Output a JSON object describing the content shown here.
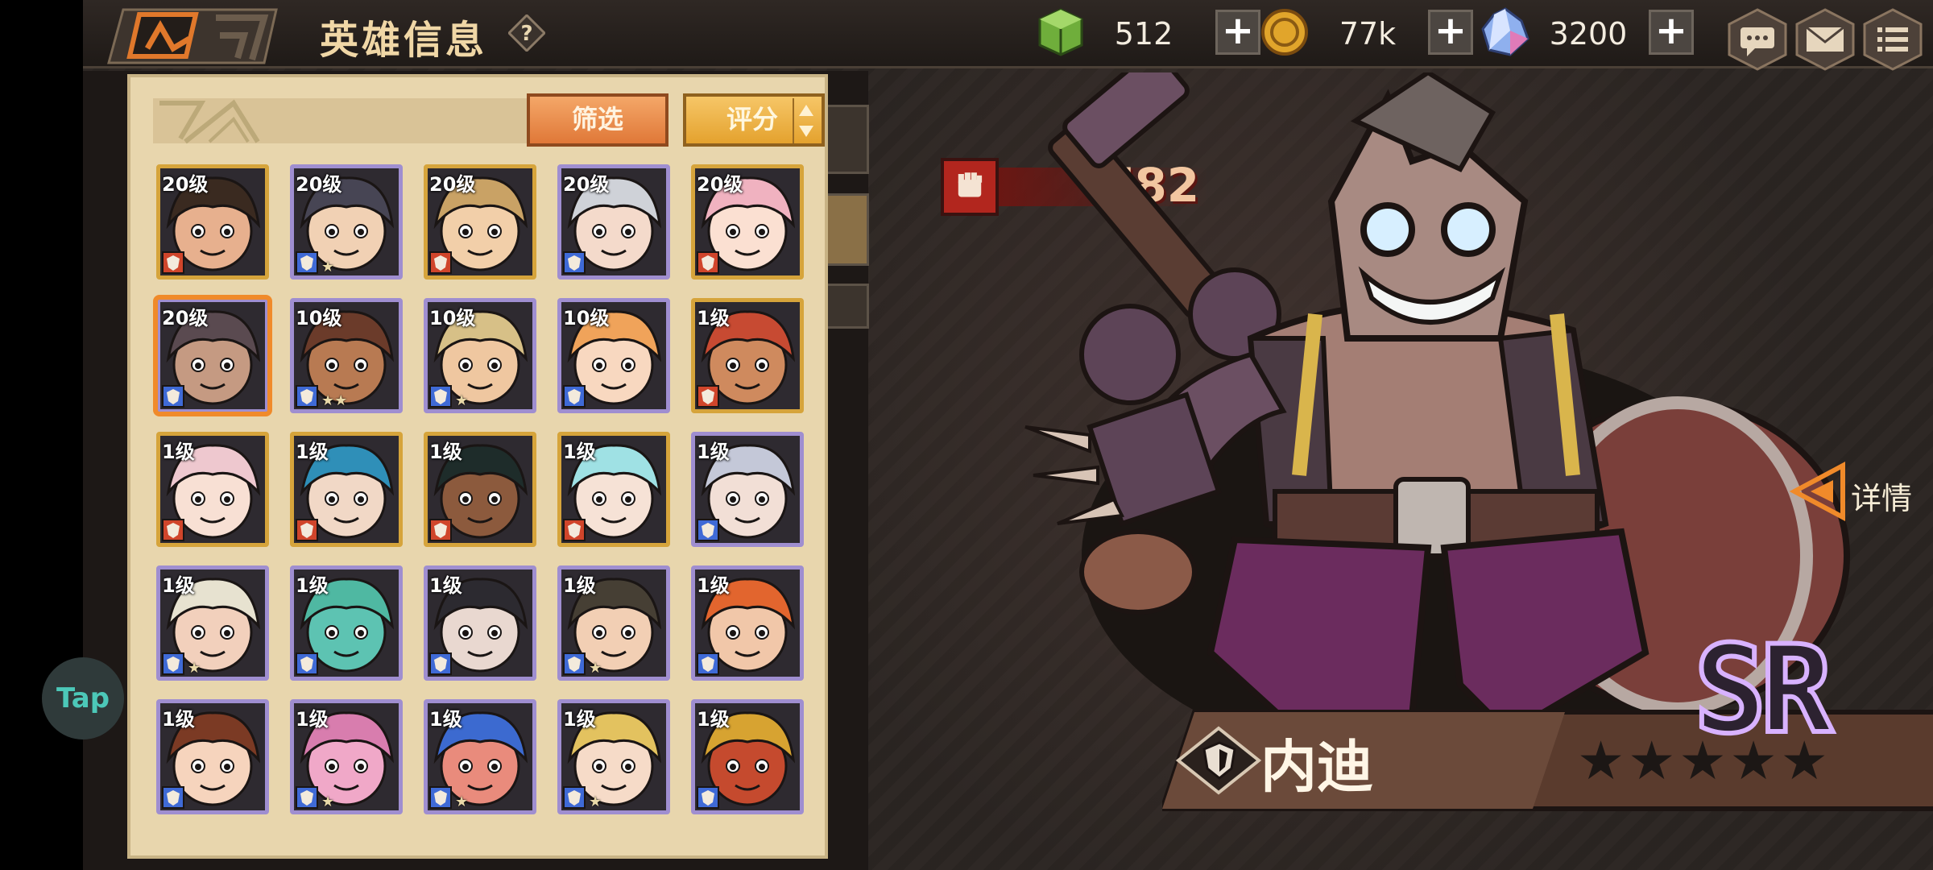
{
  "header": {
    "title": "英雄信息",
    "help_icon": "question-icon",
    "resources": [
      {
        "name": "energy",
        "icon": "green-cube-icon",
        "value": "512",
        "color": "#7fc24a"
      },
      {
        "name": "gold",
        "icon": "gold-coin-icon",
        "value": "77k",
        "color": "#e1a52b"
      },
      {
        "name": "crystal",
        "icon": "crystal-icon",
        "value": "3200",
        "color": "#9fb6f4"
      }
    ],
    "buttons": [
      "chat-icon",
      "mail-icon",
      "menu-icon"
    ]
  },
  "panel": {
    "filter_label": "筛选",
    "sort_label": "评分",
    "heroes": [
      {
        "level": "20级",
        "frame": "gold",
        "hair": "#3a2a20",
        "skin": "#e7b08e",
        "stars": ""
      },
      {
        "level": "20级",
        "frame": "purple",
        "hair": "#474554",
        "skin": "#f1d1b4",
        "stars": "★"
      },
      {
        "level": "20级",
        "frame": "gold",
        "hair": "#c9a265",
        "skin": "#f2cfa9",
        "stars": ""
      },
      {
        "level": "20级",
        "frame": "purple",
        "hair": "#cfd2d8",
        "skin": "#f4dacb",
        "stars": ""
      },
      {
        "level": "20级",
        "frame": "gold",
        "hair": "#f0b2c0",
        "skin": "#fbe0d2",
        "stars": ""
      },
      {
        "level": "20级",
        "frame": "purple",
        "hair": "#5a4a50",
        "skin": "#c59a82",
        "stars": ""
      },
      {
        "level": "10级",
        "frame": "purple",
        "hair": "#6b3b2a",
        "skin": "#b87a52",
        "stars": "★★"
      },
      {
        "level": "10级",
        "frame": "purple",
        "hair": "#d7c087",
        "skin": "#efc7a0",
        "stars": "★"
      },
      {
        "level": "10级",
        "frame": "purple",
        "hair": "#f0a35a",
        "skin": "#f8d8c0",
        "stars": ""
      },
      {
        "level": "1级",
        "frame": "gold",
        "hair": "#c74a32",
        "skin": "#cf8a5e",
        "stars": ""
      },
      {
        "level": "1级",
        "frame": "gold",
        "hair": "#eec8cf",
        "skin": "#f8e0d4",
        "stars": ""
      },
      {
        "level": "1级",
        "frame": "gold",
        "hair": "#2f8fb8",
        "skin": "#f1d8c6",
        "stars": ""
      },
      {
        "level": "1级",
        "frame": "gold",
        "hair": "#1e2c2a",
        "skin": "#8c5a3d",
        "stars": ""
      },
      {
        "level": "1级",
        "frame": "gold",
        "hair": "#9fe1e4",
        "skin": "#f6e2d6",
        "stars": ""
      },
      {
        "level": "1级",
        "frame": "purple",
        "hair": "#c4c8d8",
        "skin": "#f2dfd6",
        "stars": ""
      },
      {
        "level": "1级",
        "frame": "purple",
        "hair": "#e7e2d0",
        "skin": "#f2d0bc",
        "stars": "★"
      },
      {
        "level": "1级",
        "frame": "purple",
        "hair": "#4fb8a2",
        "skin": "#5dc3b2",
        "stars": ""
      },
      {
        "level": "1级",
        "frame": "purple",
        "hair": "#2c2a30",
        "skin": "#e9d8d0",
        "stars": ""
      },
      {
        "level": "1级",
        "frame": "purple",
        "hair": "#463f34",
        "skin": "#f2cfb4",
        "stars": "★"
      },
      {
        "level": "1级",
        "frame": "purple",
        "hair": "#e2652e",
        "skin": "#f1c7a9",
        "stars": ""
      },
      {
        "level": "1级",
        "frame": "purple",
        "hair": "#7b3a24",
        "skin": "#f6d4bd",
        "stars": ""
      },
      {
        "level": "1级",
        "frame": "purple",
        "hair": "#d87dae",
        "skin": "#f0a8c8",
        "stars": "★"
      },
      {
        "level": "1级",
        "frame": "purple",
        "hair": "#3c6ad0",
        "skin": "#e98b7c",
        "stars": "★"
      },
      {
        "level": "1级",
        "frame": "purple",
        "hair": "#e3c25f",
        "skin": "#f6dbc8",
        "stars": "★"
      },
      {
        "level": "1级",
        "frame": "purple",
        "hair": "#d7a331",
        "skin": "#c54a2e",
        "stars": ""
      }
    ]
  },
  "hero": {
    "power": "782",
    "detail_label": "详情",
    "name": "内迪",
    "rarity": "SR",
    "stars": "★★★★★",
    "class_icon": "shield-class-icon"
  },
  "overlay": {
    "tap_label": "Tap"
  }
}
